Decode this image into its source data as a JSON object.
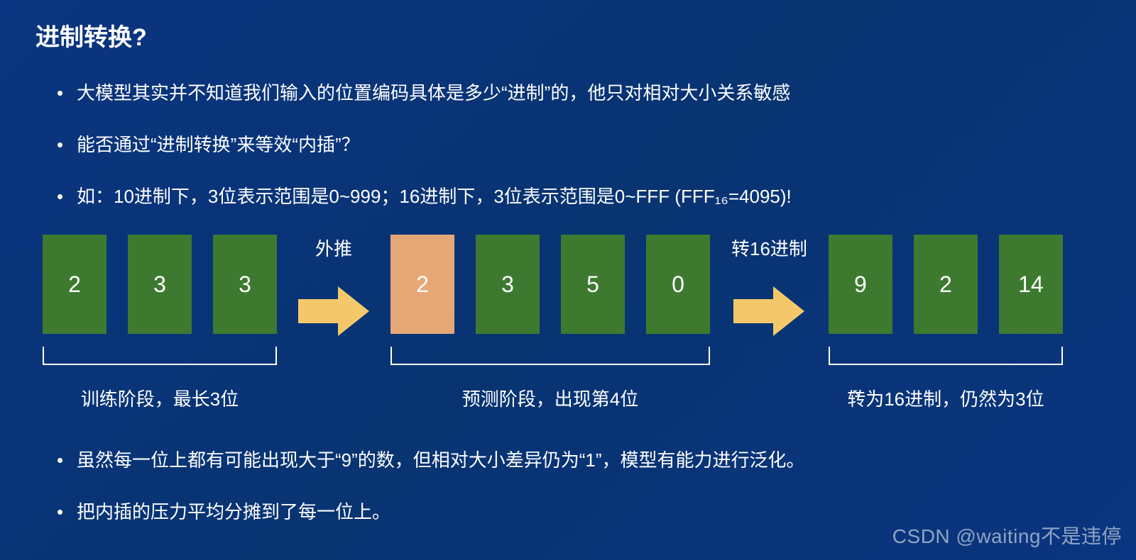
{
  "title": "进制转换?",
  "bullets_top": [
    "大模型其实并不知道我们输入的位置编码具体是多少“进制”的，他只对相对大小关系敏感",
    "能否通过“进制转换”来等效“内插”？",
    "如：10进制下，3位表示范围是0~999；16进制下，3位表示范围是0~FFF (FFF₁₆=4095)!"
  ],
  "bullets_bottom": [
    "虽然每一位上都有可能出现大于“9”的数，但相对大小差异仍为“1”，模型有能力进行泛化。",
    "把内插的压力平均分摊到了每一位上。"
  ],
  "diagram": {
    "group1": {
      "digits": [
        "2",
        "3",
        "3"
      ],
      "caption": "训练阶段，最长3位"
    },
    "arrow1_label": "外推",
    "group2": {
      "digits": [
        "2",
        "3",
        "5",
        "0"
      ],
      "highlight_index": 0,
      "caption": "预测阶段，出现第4位"
    },
    "arrow2_label": "转16进制",
    "group3": {
      "digits": [
        "9",
        "2",
        "14"
      ],
      "caption": "转为16进制，仍然为3位"
    }
  },
  "watermark": "CSDN @waiting不是违停"
}
